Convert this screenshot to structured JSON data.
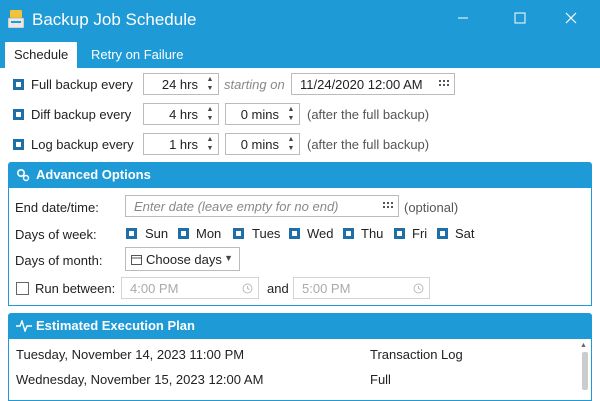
{
  "window": {
    "title": "Backup Job Schedule"
  },
  "tabs": [
    {
      "label": "Schedule"
    },
    {
      "label": "Retry on Failure"
    }
  ],
  "full": {
    "label": "Full backup every",
    "interval": "24 hrs",
    "starting_on": "starting on",
    "datetime": "11/24/2020 12:00 AM"
  },
  "diff": {
    "label": "Diff backup every",
    "interval": "4 hrs",
    "offset": "0 mins",
    "note": "(after the full backup)"
  },
  "log": {
    "label": "Log backup every",
    "interval": "1 hrs",
    "offset": "0 mins",
    "note": "(after the full backup)"
  },
  "advanced": {
    "title": "Advanced Options",
    "end_date_label": "End date/time:",
    "end_date_placeholder": "Enter date (leave empty for no end)",
    "optional": "(optional)",
    "days_of_week_label": "Days of week:",
    "days": [
      "Sun",
      "Mon",
      "Tues",
      "Wed",
      "Thu",
      "Fri",
      "Sat"
    ],
    "days_of_month_label": "Days of month:",
    "days_of_month_value": "Choose days",
    "run_between_label": "Run between:",
    "run_from": "4:00 PM",
    "and": "and",
    "run_to": "5:00 PM"
  },
  "plan": {
    "title": "Estimated Execution Plan",
    "rows": [
      {
        "time": "Tuesday, November 14, 2023 11:00 PM",
        "type": "Transaction Log"
      },
      {
        "time": "Wednesday, November 15, 2023 12:00 AM",
        "type": "Full"
      }
    ]
  }
}
